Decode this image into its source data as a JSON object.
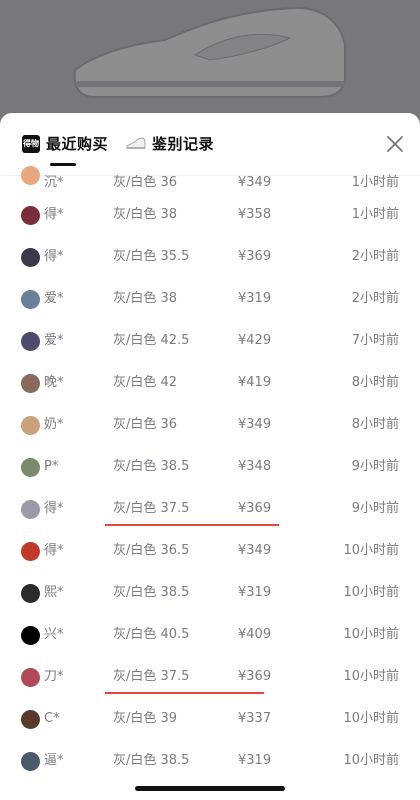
{
  "tabs": [
    {
      "label": "最近购买",
      "icon": "brand-logo-icon",
      "logo_text": "得物",
      "active": true
    },
    {
      "label": "鉴别记录",
      "icon": "sneaker-icon",
      "active": false
    }
  ],
  "close_icon": "close-icon",
  "records": [
    {
      "user": "沉*",
      "spec": "灰/白色 36",
      "price": "¥349",
      "time": "1小时前",
      "avatar_color": "#e9a77f"
    },
    {
      "user": "得*",
      "spec": "灰/白色 38",
      "price": "¥358",
      "time": "1小时前",
      "avatar_color": "#7a2d3a"
    },
    {
      "user": "得*",
      "spec": "灰/白色 35.5",
      "price": "¥369",
      "time": "2小时前",
      "avatar_color": "#3a3a4a"
    },
    {
      "user": "爱*",
      "spec": "灰/白色 38",
      "price": "¥319",
      "time": "2小时前",
      "avatar_color": "#6a7f9a"
    },
    {
      "user": "爱*",
      "spec": "灰/白色 42.5",
      "price": "¥429",
      "time": "7小时前",
      "avatar_color": "#4b4b6e"
    },
    {
      "user": "晚*",
      "spec": "灰/白色 42",
      "price": "¥419",
      "time": "8小时前",
      "avatar_color": "#8a6a5a"
    },
    {
      "user": "奶*",
      "spec": "灰/白色 36",
      "price": "¥349",
      "time": "8小时前",
      "avatar_color": "#c9a27a"
    },
    {
      "user": "P*",
      "spec": "灰/白色 38.5",
      "price": "¥348",
      "time": "9小时前",
      "avatar_color": "#7a8a6a"
    },
    {
      "user": "得*",
      "spec": "灰/白色 37.5",
      "price": "¥369",
      "time": "9小时前",
      "avatar_color": "#9a9aa8",
      "underline": "a"
    },
    {
      "user": "得*",
      "spec": "灰/白色 36.5",
      "price": "¥349",
      "time": "10小时前",
      "avatar_color": "#c0392b"
    },
    {
      "user": "熙*",
      "spec": "灰/白色 38.5",
      "price": "¥319",
      "time": "10小时前",
      "avatar_color": "#2b2b2b"
    },
    {
      "user": "兴*",
      "spec": "灰/白色 40.5",
      "price": "¥409",
      "time": "10小时前",
      "avatar_color": "#000000"
    },
    {
      "user": "刀*",
      "spec": "灰/白色 37.5",
      "price": "¥369",
      "time": "10小时前",
      "avatar_color": "#b04a5a",
      "underline": "b"
    },
    {
      "user": "C*",
      "spec": "灰/白色 39",
      "price": "¥337",
      "time": "10小时前",
      "avatar_color": "#5a3a2a"
    },
    {
      "user": "逼*",
      "spec": "灰/白色 38.5",
      "price": "¥319",
      "time": "10小时前",
      "avatar_color": "#4a5a6a"
    }
  ]
}
